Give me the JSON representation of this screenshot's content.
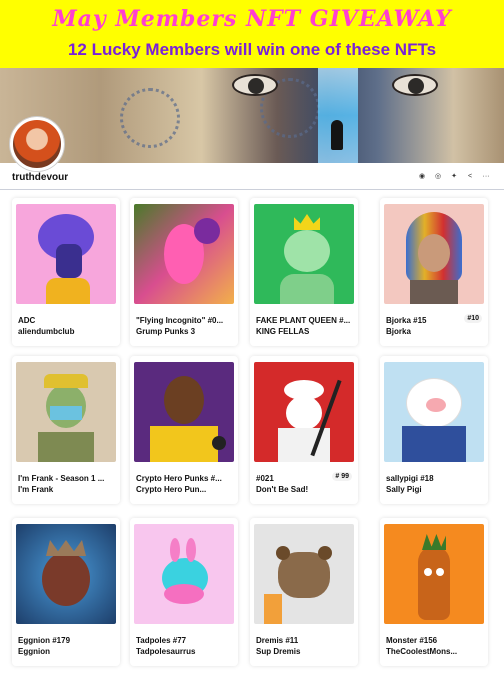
{
  "banner": {
    "title": "May Members NFT GIVEAWAY",
    "subtitle": "12 Lucky Members will win one of these NFTs"
  },
  "profile": {
    "username": "truthdevour",
    "social_icons": [
      "globe-icon",
      "instagram-icon",
      "twitter-icon",
      "share-icon",
      "more-icon"
    ]
  },
  "cards": [
    {
      "name": "ADC",
      "collection": "aliendumbclub",
      "rank": ""
    },
    {
      "name": "\"Flying Incognito\" #0...",
      "collection": "Grump Punks 3",
      "rank": ""
    },
    {
      "name": "FAKE PLANT QUEEN #...",
      "collection": "KING FELLAS",
      "rank": ""
    },
    {
      "name": "Bjorka #15",
      "collection": "Bjorka",
      "rank": "#10"
    },
    {
      "name": "I'm Frank - Season 1 ...",
      "collection": "I'm Frank",
      "rank": ""
    },
    {
      "name": "Crypto Hero Punks #...",
      "collection": "Crypto Hero Pun...",
      "rank": ""
    },
    {
      "name": "#021",
      "collection": "Don't Be Sad!",
      "rank": "# 99"
    },
    {
      "name": "sallypigi #18",
      "collection": "Sally Pigi",
      "rank": ""
    },
    {
      "name": "Eggnion #179",
      "collection": "Eggnion",
      "rank": ""
    },
    {
      "name": "Tadpoles #77",
      "collection": "Tadpolesaurrus",
      "rank": ""
    },
    {
      "name": "Dremis #11",
      "collection": "Sup Dremis",
      "rank": ""
    },
    {
      "name": "Monster #156",
      "collection": "TheCoolestMons...",
      "rank": ""
    }
  ],
  "colors": {
    "banner_bg": "#ffff00",
    "title_pink": "#ff3fd0",
    "subtitle_purple": "#7a22d8"
  }
}
